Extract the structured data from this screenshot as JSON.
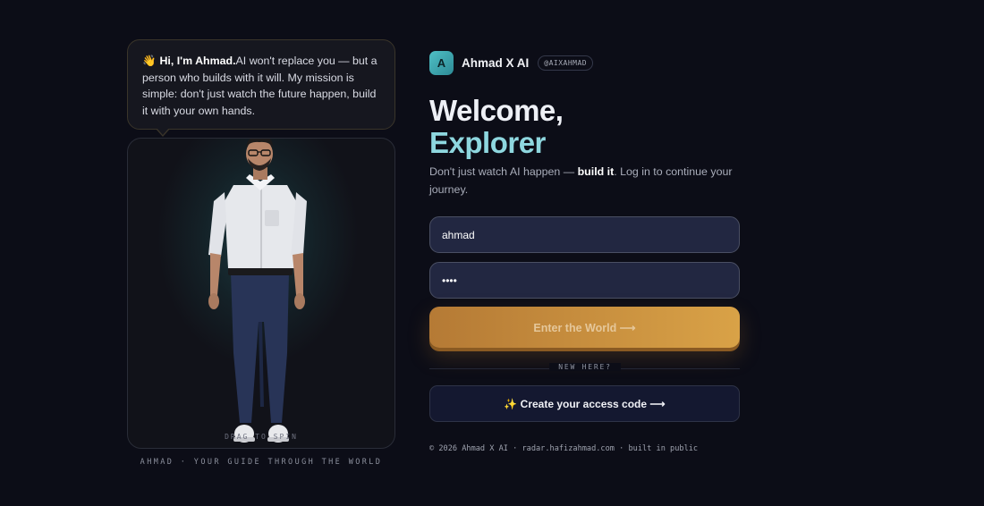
{
  "guide": {
    "wave_emoji": "👋",
    "greeting_bold": "Hi, I'm Ahmad.",
    "greeting_rest": "AI won't replace you — but a person who builds with it will. My mission is simple: don't just watch the future happen, build it with your own hands.",
    "drag_hint": "DRAG TO SPIN",
    "caption": "AHMAD · YOUR GUIDE THROUGH THE WORLD"
  },
  "brand": {
    "logo_letter": "A",
    "name": "Ahmad X AI",
    "handle": "@AIXAHMAD"
  },
  "hero": {
    "title_line1": "Welcome,",
    "title_line2": "Explorer",
    "subtitle_prefix": "Don't just watch AI happen — ",
    "subtitle_bold": "build it",
    "subtitle_suffix": ". Log in to continue your journey."
  },
  "form": {
    "username_value": "ahmad",
    "password_value": "••••",
    "submit_label": "Enter the World ⟶",
    "divider_label": "NEW HERE?",
    "create_label": "✨ Create your access code ⟶"
  },
  "footer": {
    "text": "© 2026 Ahmad X AI · radar.hafizahmad.com · built in public"
  },
  "colors": {
    "background": "#0c0d17",
    "accent_teal": "#8ed7df",
    "accent_gold": "#d9a247"
  }
}
